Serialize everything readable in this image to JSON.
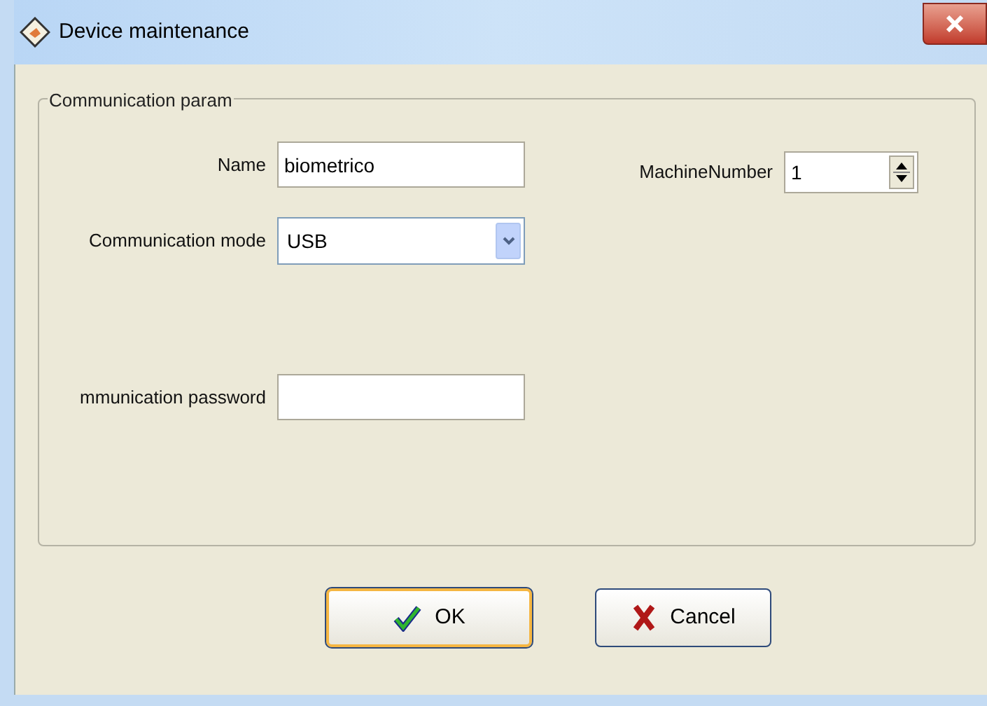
{
  "window": {
    "title": "Device maintenance"
  },
  "group": {
    "title": "Communication param",
    "fields": [
      {
        "kind": "text",
        "label": "Name",
        "value": "biometrico"
      },
      {
        "kind": "spinner",
        "label": "MachineNumber",
        "value": "1"
      },
      {
        "kind": "select",
        "label": "Communication mode",
        "value": "USB"
      },
      {
        "kind": "text",
        "label": "mmunication password"
      }
    ]
  },
  "buttons": [
    {
      "kind": "ok",
      "label": "OK",
      "default": true
    },
    {
      "kind": "cancel",
      "label": "Cancel",
      "default": false
    }
  ]
}
